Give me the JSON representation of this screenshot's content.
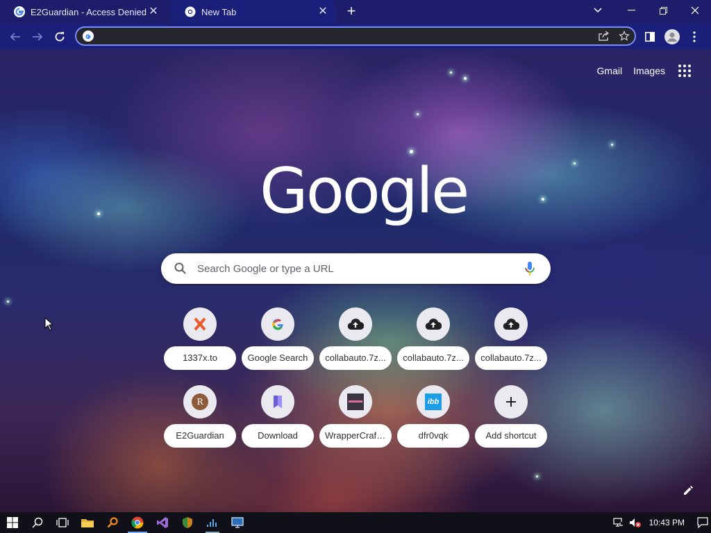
{
  "tabs": [
    {
      "title": "E2Guardian - Access Denied",
      "active": false
    },
    {
      "title": "New Tab",
      "active": true
    }
  ],
  "toolbar": {
    "address_value": "",
    "address_placeholder": ""
  },
  "header_links": {
    "gmail": "Gmail",
    "images": "Images"
  },
  "logo_text": "Google",
  "search": {
    "placeholder": "Search Google or type a URL"
  },
  "shortcuts": [
    {
      "label": "1337x.to",
      "icon": "x-letter-icon"
    },
    {
      "label": "Google Search",
      "icon": "google-g-icon"
    },
    {
      "label": "collabauto.7z...",
      "icon": "cloud-upload-icon"
    },
    {
      "label": "collabauto.7z...",
      "icon": "cloud-upload-icon"
    },
    {
      "label": "collabauto.7z...",
      "icon": "cloud-upload-icon"
    },
    {
      "label": "E2Guardian",
      "icon": "r-letter-icon",
      "icon_text": "R"
    },
    {
      "label": "Download",
      "icon": "bookmark-icon"
    },
    {
      "label": "WrapperCraft...",
      "icon": "site-thumbnail-icon"
    },
    {
      "label": "dfr0vqk",
      "icon": "ibb-logo-icon",
      "icon_text": "ibb"
    },
    {
      "label": "Add shortcut",
      "icon": "plus-icon"
    }
  ],
  "taskbar": {
    "clock": "10:43 PM"
  },
  "colors": {
    "tab_strip": "#1d1d6b",
    "toolbar": "#1a1f7a",
    "omnibox_border": "#7d8cff",
    "taskbar": "#101018"
  }
}
